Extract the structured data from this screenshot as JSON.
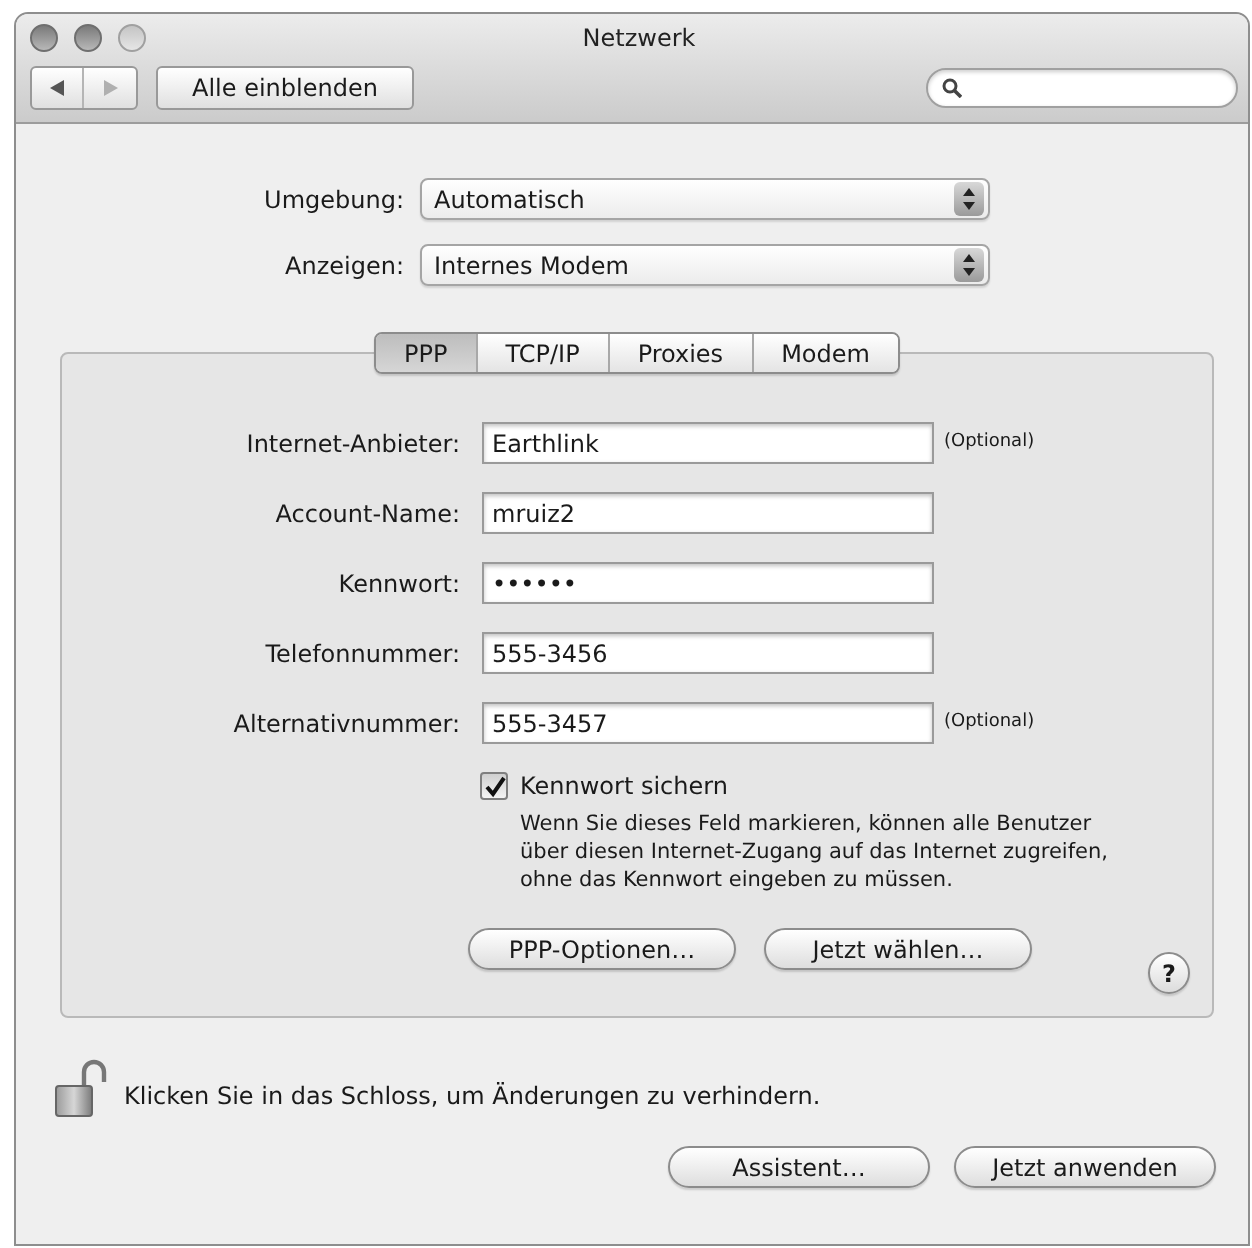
{
  "window": {
    "title": "Netzwerk"
  },
  "toolbar": {
    "navigation": [
      {
        "kind": "back",
        "disabled": false
      },
      {
        "kind": "forward",
        "disabled": true
      }
    ],
    "show_all_button": "Alle einblenden"
  },
  "popups": [
    {
      "label": "Umgebung:",
      "value": "Automatisch"
    },
    {
      "label": "Anzeigen:",
      "value": "Internes Modem"
    }
  ],
  "tabs": [
    {
      "label": "PPP",
      "selected": true
    },
    {
      "label": "TCP/IP",
      "selected": false
    },
    {
      "label": "Proxies",
      "selected": false
    },
    {
      "label": "Modem",
      "selected": false
    }
  ],
  "fields": [
    {
      "label": "Internet-Anbieter:",
      "value": "Earthlink",
      "note": "(Optional)"
    },
    {
      "label": "Account-Name:",
      "value": "mruiz2"
    },
    {
      "label": "Kennwort:",
      "value": "••••••"
    },
    {
      "label": "Telefonnummer:",
      "value": "555-3456"
    },
    {
      "label": "Alternativnummer:",
      "value": "555-3457",
      "note": "(Optional)"
    }
  ],
  "save_password": {
    "label": "Kennwort sichern",
    "checked": true,
    "description": "Wenn Sie dieses Feld markieren, können alle Benutzer über diesen Internet-Zugang auf das Internet zugreifen, ohne das Kennwort eingeben zu müssen."
  },
  "panel_buttons": [
    "PPP-Optionen…",
    "Jetzt wählen…"
  ],
  "help_button": "?",
  "lock": {
    "locked": false,
    "message": "Klicken Sie in das Schloss, um Änderungen zu verhindern."
  },
  "footer_buttons": [
    "Assistent…",
    "Jetzt anwenden"
  ]
}
